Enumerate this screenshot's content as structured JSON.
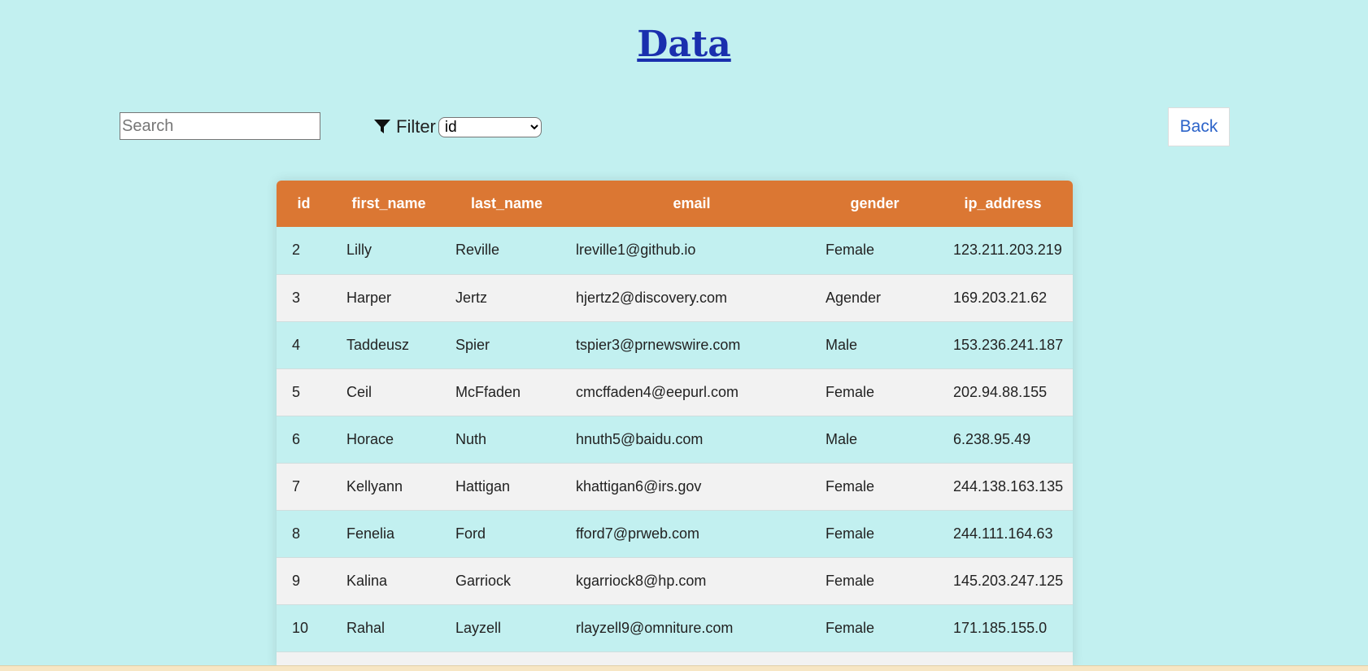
{
  "page": {
    "title": "Data"
  },
  "toolbar": {
    "search_placeholder": "Search",
    "search_value": "",
    "filter_label": "Filter",
    "filter_icon": "funnel-icon",
    "filter_selected": "id",
    "back_label": "Back"
  },
  "colors": {
    "background": "#c2f0f0",
    "header": "#db7733",
    "title": "#1a2fae",
    "back_text": "#2c63c9"
  },
  "table": {
    "columns": [
      "id",
      "first_name",
      "last_name",
      "email",
      "gender",
      "ip_address"
    ],
    "rows": [
      [
        "2",
        "Lilly",
        "Reville",
        "lreville1@github.io",
        "Female",
        "123.211.203.219"
      ],
      [
        "3",
        "Harper",
        "Jertz",
        "hjertz2@discovery.com",
        "Agender",
        "169.203.21.62"
      ],
      [
        "4",
        "Taddeusz",
        "Spier",
        "tspier3@prnewswire.com",
        "Male",
        "153.236.241.187"
      ],
      [
        "5",
        "Ceil",
        "McFfaden",
        "cmcffaden4@eepurl.com",
        "Female",
        "202.94.88.155"
      ],
      [
        "6",
        "Horace",
        "Nuth",
        "hnuth5@baidu.com",
        "Male",
        "6.238.95.49"
      ],
      [
        "7",
        "Kellyann",
        "Hattigan",
        "khattigan6@irs.gov",
        "Female",
        "244.138.163.135"
      ],
      [
        "8",
        "Fenelia",
        "Ford",
        "fford7@prweb.com",
        "Female",
        "244.111.164.63"
      ],
      [
        "9",
        "Kalina",
        "Garriock",
        "kgarriock8@hp.com",
        "Female",
        "145.203.247.125"
      ],
      [
        "10",
        "Rahal",
        "Layzell",
        "rlayzell9@omniture.com",
        "Female",
        "171.185.155.0"
      ],
      [
        "",
        "",
        "",
        "",
        "",
        ""
      ]
    ]
  }
}
